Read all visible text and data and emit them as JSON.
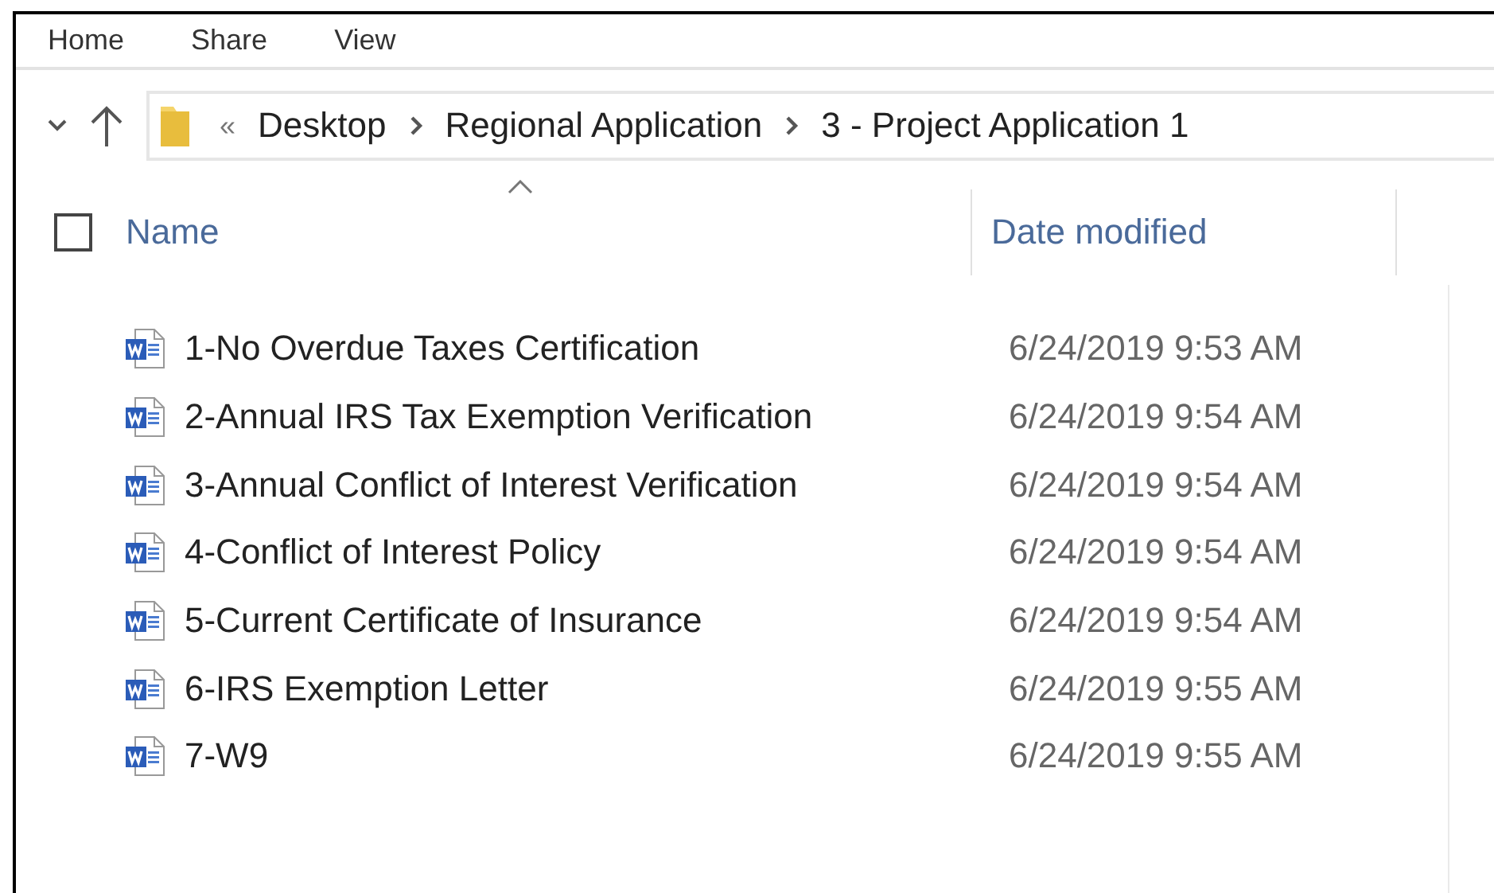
{
  "ribbon_tabs": [
    {
      "label": "Home"
    },
    {
      "label": "Share"
    },
    {
      "label": "View"
    }
  ],
  "address_bar": {
    "overflow": "«",
    "path": [
      "Desktop",
      "Regional Application",
      "3 - Project Application 1"
    ]
  },
  "columns": [
    {
      "label": "Name",
      "sorted": true
    },
    {
      "label": "Date modified",
      "sorted": false
    }
  ],
  "select_all": {
    "checked": false
  },
  "files": [
    {
      "name": "1-No Overdue Taxes Certification",
      "date_modified": "6/24/2019 9:53 AM"
    },
    {
      "name": "2-Annual IRS Tax Exemption Verification",
      "date_modified": "6/24/2019 9:54 AM"
    },
    {
      "name": "3-Annual Conflict of Interest Verification",
      "date_modified": "6/24/2019 9:54 AM"
    },
    {
      "name": "4-Conflict of Interest Policy",
      "date_modified": "6/24/2019 9:54 AM"
    },
    {
      "name": "5-Current Certificate of Insurance",
      "date_modified": "6/24/2019 9:54 AM"
    },
    {
      "name": "6-IRS Exemption Letter",
      "date_modified": "6/24/2019 9:55 AM"
    },
    {
      "name": "7-W9",
      "date_modified": "6/24/2019 9:55 AM"
    }
  ]
}
